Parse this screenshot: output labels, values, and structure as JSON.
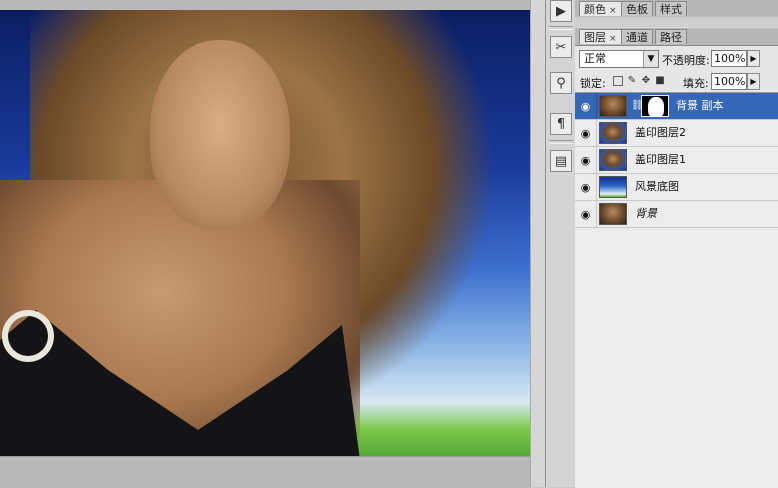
{
  "panel_groups": {
    "color_tabs": [
      {
        "label": "颜色",
        "has_close": true,
        "active": true
      },
      {
        "label": "色板",
        "has_close": false,
        "active": false
      },
      {
        "label": "样式",
        "has_close": false,
        "active": false
      }
    ],
    "layer_tabs": [
      {
        "label": "图层",
        "has_close": true,
        "active": true
      },
      {
        "label": "通道",
        "has_close": false,
        "active": false
      },
      {
        "label": "路径",
        "has_close": false,
        "active": false
      }
    ]
  },
  "tabs_close_glyph": "×",
  "layers_panel": {
    "blend_mode": "正常",
    "opacity_label": "不透明度:",
    "opacity_value": "100%",
    "lock_label": "锁定:",
    "fill_label": "填充:",
    "fill_value": "100%",
    "layers": [
      {
        "name": "背景 副本",
        "thumb": "portrait",
        "has_mask": true,
        "selected": true,
        "italic": false
      },
      {
        "name": "盖印图层2",
        "thumb": "portrait-sky",
        "has_mask": false,
        "selected": false,
        "italic": false
      },
      {
        "name": "盖印图层1",
        "thumb": "portrait-sky",
        "has_mask": false,
        "selected": false,
        "italic": false
      },
      {
        "name": "风景底图",
        "thumb": "scenery",
        "has_mask": false,
        "selected": false,
        "italic": false
      },
      {
        "name": "背景",
        "thumb": "portrait",
        "has_mask": false,
        "selected": false,
        "italic": true
      }
    ]
  },
  "tool_strip_icons": [
    "play-icon",
    "brush-settings-icon",
    "clone-source-icon",
    "paragraph-icon",
    "layer-comps-icon"
  ],
  "glyphs": {
    "play": "▶",
    "brush": "✂",
    "clone": "⚲",
    "paragraph": "¶",
    "comps": "▤",
    "eye": "◉",
    "dropdown": "▼",
    "stepper": "▶",
    "chain": "⛓"
  }
}
